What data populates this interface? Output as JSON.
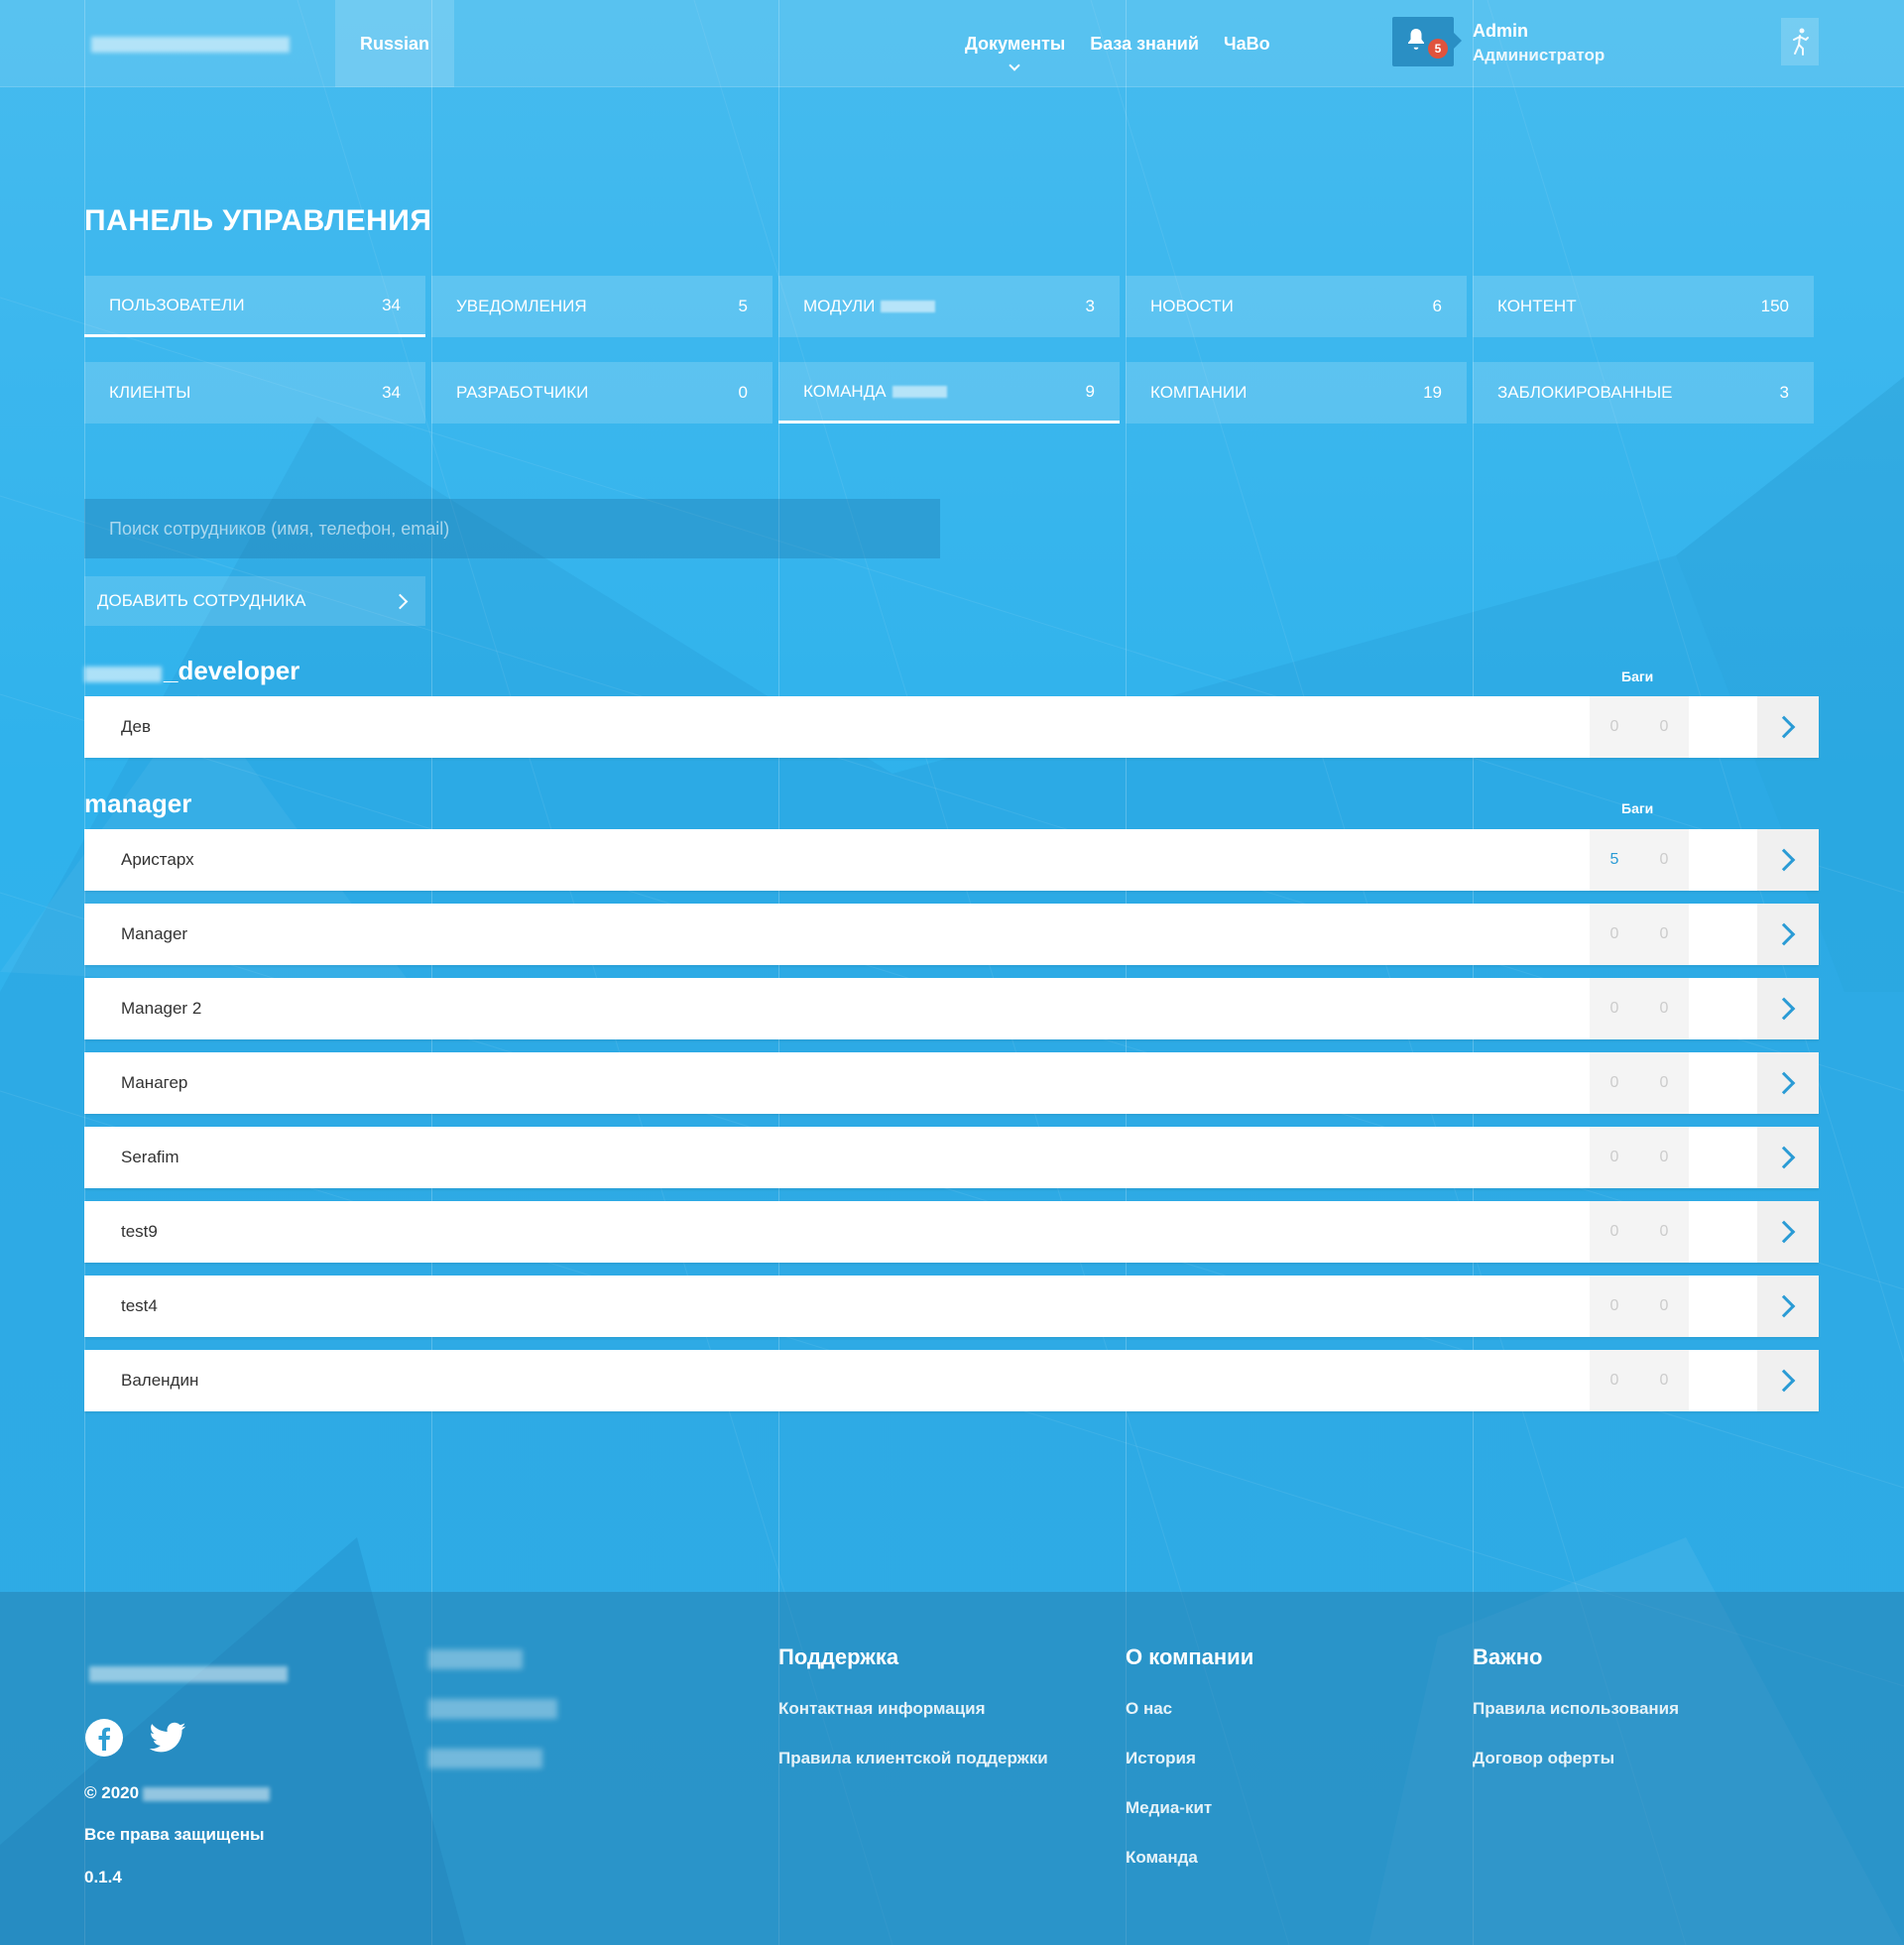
{
  "header": {
    "language": "Russian",
    "nav": [
      {
        "label": "Документы",
        "has_dropdown": true
      },
      {
        "label": "База знаний"
      },
      {
        "label": "ЧаВо"
      }
    ],
    "notifications_count": "5",
    "user_name": "Admin",
    "user_role": "Администратор"
  },
  "page_title": "ПАНЕЛЬ УПРАВЛЕНИЯ",
  "tiles": [
    {
      "label": "Пользователи",
      "count": "34",
      "active": true
    },
    {
      "label": "Уведомления",
      "count": "5"
    },
    {
      "label": "Модули",
      "count": "3",
      "redacted": true
    },
    {
      "label": "Новости",
      "count": "6"
    },
    {
      "label": "Контент",
      "count": "150"
    },
    {
      "label": "Клиенты",
      "count": "34"
    },
    {
      "label": "Разработчики",
      "count": "0"
    },
    {
      "label": "Команда",
      "count": "9",
      "redacted": true,
      "active": true
    },
    {
      "label": "Компании",
      "count": "19"
    },
    {
      "label": "Заблокированные",
      "count": "3"
    }
  ],
  "search": {
    "placeholder": "Поиск сотрудников (имя, телефон, email)"
  },
  "add_button": "Добавить сотрудника",
  "groups": [
    {
      "title": "_developer",
      "title_redacted_prefix": true,
      "column_header": "Баги",
      "rows": [
        {
          "name": "Дев",
          "c1": "0",
          "c2": "0"
        }
      ]
    },
    {
      "title": "manager",
      "column_header": "Баги",
      "rows": [
        {
          "name": "Аристарх",
          "c1": "5",
          "c2": "0",
          "highlight": true
        },
        {
          "name": "Manager",
          "c1": "0",
          "c2": "0"
        },
        {
          "name": "Manager 2",
          "c1": "0",
          "c2": "0"
        },
        {
          "name": "Манагер",
          "c1": "0",
          "c2": "0"
        },
        {
          "name": "Serafim",
          "c1": "0",
          "c2": "0"
        },
        {
          "name": "test9",
          "c1": "0",
          "c2": "0"
        },
        {
          "name": "test4",
          "c1": "0",
          "c2": "0"
        },
        {
          "name": "Валендин",
          "c1": "0",
          "c2": "0"
        }
      ]
    }
  ],
  "footer": {
    "copyright": "© 2020",
    "rights": "Все права защищены",
    "version": "0.1.4",
    "social": [
      "facebook-icon",
      "twitter-icon"
    ],
    "columns": [
      {
        "title": "Поддержка",
        "links": [
          "Контактная информация",
          "Правила клиентской поддержки"
        ]
      },
      {
        "title": "О компании",
        "links": [
          "О нас",
          "История",
          "Медиа-кит",
          "Команда"
        ]
      },
      {
        "title": "Важно",
        "links": [
          "Правила использования",
          "Договор оферты"
        ]
      }
    ]
  }
}
